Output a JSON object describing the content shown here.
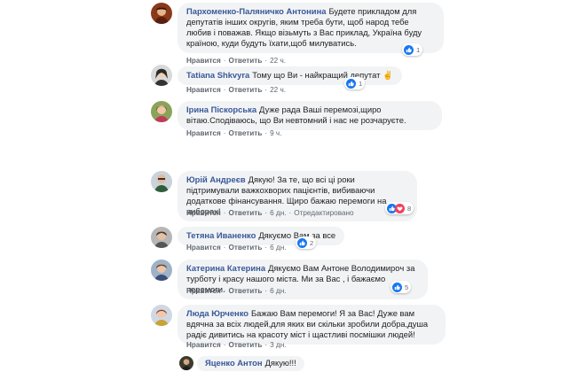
{
  "colors": {
    "author": "#385898",
    "bubble": "#f2f3f5",
    "meta": "#606770",
    "like": "#1877f2",
    "love": "#f33e58"
  },
  "comments": [
    {
      "author": "Пархоменко-Паляничко Антонина",
      "text": "Будете прикладом для депутатів інших округів, яким треба бути, щоб народ тебе любив і поважав. Якщо візьмуть з Вас приклад, Україна буду країною, куди будуть їхати,щоб милуватись.",
      "like": "Нравится",
      "reply": "Ответить",
      "time": "22 ч.",
      "reaction_count": "1",
      "avatar_icon": "user-photo-icon"
    },
    {
      "author": "Tatiana Shkvyra",
      "text": "Тому що Ви - найкращий депутат ✌",
      "like": "Нравится",
      "reply": "Ответить",
      "time": "22 ч.",
      "reaction_count": "1",
      "avatar_icon": "user-photo-icon"
    },
    {
      "author": "Ірина Піскорська",
      "text": "Дуже рада Ваші перемозі,щиро вітаю.Сподіваюсь, що Ви невтомний і нас не розчаруєте.",
      "like": "Нравится",
      "reply": "Ответить",
      "time": "9 ч.",
      "avatar_icon": "user-photo-icon"
    },
    {
      "author": "Юрій Андреєв",
      "text": "Дякую! За те, що всі ці роки підтримували важкохворих пацієнтів, вибиваючи додаткове фінансування. Щиро бажаю перемоги на виборах!",
      "like": "Нравится",
      "reply": "Ответить",
      "time": "6 дн.",
      "edited": "Отредактировано",
      "reaction_count": "8",
      "avatar_icon": "user-photo-icon"
    },
    {
      "author": "Тетяна Иваненко",
      "text": "Дякуємо Вам за все",
      "like": "Нравится",
      "reply": "Ответить",
      "time": "6 дн.",
      "reaction_count": "2",
      "avatar_icon": "user-photo-icon"
    },
    {
      "author": "Катерина Катерина",
      "text": "Дякуємо Вам Антоне Володимирoч за турботу і красу нашого міста. Ми за Вас , і бажаємо перемоги.",
      "like": "Нравится",
      "reply": "Ответить",
      "time": "6 дн.",
      "reaction_count": "5",
      "avatar_icon": "user-photo-icon"
    },
    {
      "author": "Люда Юрченко",
      "text": "Бажаю Вам перемоги! Я за Вас! Дуже вам вдячна за всіх людей,для яких ви скільки зробили добра,душа радіє дивитись на красоту міст і щастливі посмішки людей!",
      "like": "Нравится",
      "reply": "Ответить",
      "time": "3 дн.",
      "avatar_icon": "user-photo-icon"
    },
    {
      "author": "Яценко Антон",
      "text": "Дякую!!!",
      "avatar_icon": "user-photo-icon"
    }
  ]
}
